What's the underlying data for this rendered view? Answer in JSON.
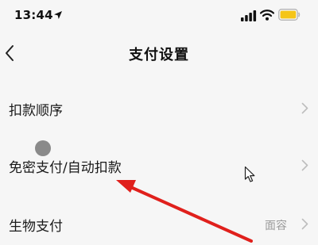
{
  "status_bar": {
    "time": "13:44",
    "icons": [
      "location-arrow-icon",
      "signal-icon",
      "wifi-icon",
      "battery-icon"
    ],
    "battery_color": "#f5c518"
  },
  "header": {
    "back_icon": "chevron-left-icon",
    "title": "支付设置"
  },
  "menu": {
    "items": [
      {
        "label": "扣款顺序",
        "value": ""
      },
      {
        "label": "免密支付/自动扣款",
        "value": ""
      },
      {
        "label": "生物支付",
        "value": "面容"
      }
    ]
  },
  "overlays": {
    "annotation_arrow_color": "#e0201c",
    "touch_indicator_color": "#8a8a8a",
    "cursor_icon": "mouse-pointer-icon"
  }
}
